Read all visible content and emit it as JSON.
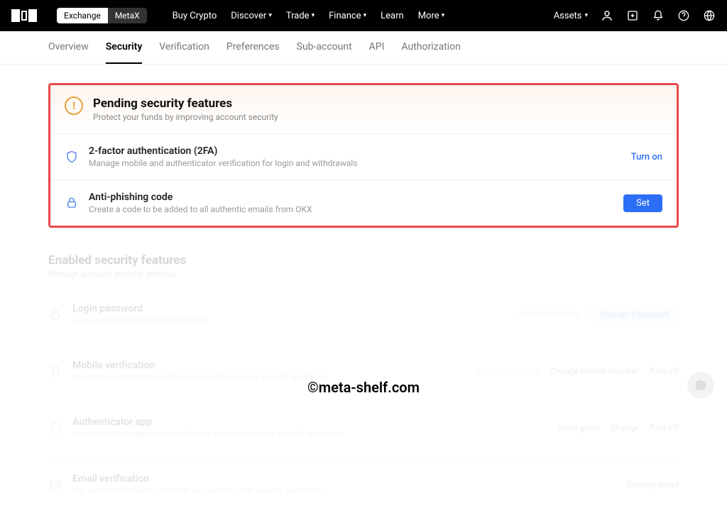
{
  "top": {
    "mode": {
      "exchange": "Exchange",
      "metax": "MetaX"
    },
    "nav": {
      "buy": "Buy Crypto",
      "discover": "Discover",
      "trade": "Trade",
      "finance": "Finance",
      "learn": "Learn",
      "more": "More"
    },
    "assets": "Assets"
  },
  "tabs": {
    "overview": "Overview",
    "security": "Security",
    "verification": "Verification",
    "preferences": "Preferences",
    "subaccount": "Sub-account",
    "api": "API",
    "authorization": "Authorization"
  },
  "pending": {
    "title": "Pending security features",
    "subtitle": "Protect your funds by improving account security",
    "twofa": {
      "title": "2-factor authentication (2FA)",
      "desc": "Manage mobile and authenticator verification for login and withdrawals",
      "action": "Turn on"
    },
    "phish": {
      "title": "Anti-phishing code",
      "desc": "Create a code to be added to all authentic emails from OKX",
      "action": "Set"
    }
  },
  "enabled": {
    "title": "Enabled security features",
    "subtitle": "Manage account security settings",
    "login": {
      "title": "Login password",
      "desc": "Login password protects account login",
      "action": "Change Password"
    },
    "mobile": {
      "title": "Mobile verification",
      "desc": "Use mobile verification to withdraw and perform other security operations",
      "change": "Change Mobile Number",
      "off": "Turn off"
    },
    "auth": {
      "title": "Authenticator app",
      "desc": "Use authenticator app code to withdraw and perform other security operations",
      "guide": "Read guide",
      "change": "Change",
      "off": "Turn off"
    },
    "email": {
      "title": "Email verification",
      "desc": "Use email verification to withdraw and perform other security operations",
      "change": "Change email"
    }
  },
  "watermark": "©meta-shelf.com"
}
